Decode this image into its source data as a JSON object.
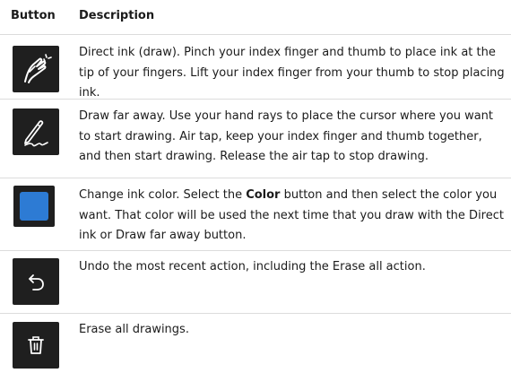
{
  "table": {
    "headers": {
      "button": "Button",
      "description": "Description"
    },
    "rows": [
      {
        "icon": "direct-ink-icon",
        "description": "Direct ink (draw). Pinch your index finger and thumb to place ink at the tip of your fingers. Lift your index finger from your thumb to stop placing ink."
      },
      {
        "icon": "draw-far-away-icon",
        "description": "Draw far away. Use your hand rays to place the cursor where you want to start drawing. Air tap, keep your index finger and thumb together, and then start drawing. Release the air tap to stop drawing."
      },
      {
        "icon": "ink-color-icon",
        "description_before": "Change ink color. Select the ",
        "description_bold": "Color",
        "description_after": " button and then select the color you want. That color will be used the next time that you draw with the Direct ink or Draw far away button."
      },
      {
        "icon": "undo-icon",
        "description": "Undo the most recent action, including the Erase all action."
      },
      {
        "icon": "trash-icon",
        "description": "Erase all drawings."
      }
    ]
  },
  "colors": {
    "icon_background": "#1f1f1f",
    "icon_foreground": "#ffffff",
    "swatch_color": "#2d7bd4",
    "divider": "#dcdcdc"
  }
}
